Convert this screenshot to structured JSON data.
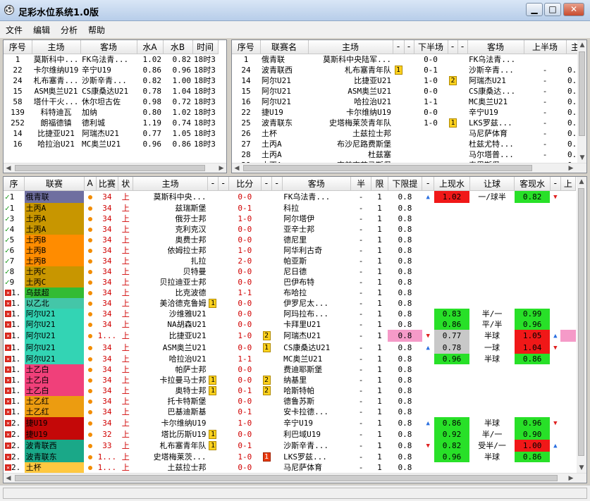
{
  "window": {
    "title": "足彩水位系统1.0版",
    "min": "▁",
    "max": "□",
    "close": "✕"
  },
  "menu": [
    "文件",
    "编辑",
    "分析",
    "帮助"
  ],
  "top_left": {
    "headers": [
      "序号",
      "主场",
      "客场",
      "水A",
      "水B",
      "时间"
    ],
    "rows": [
      [
        "1",
        "莫斯科中...",
        "FK乌法青...",
        "1.02",
        "0.82",
        "18时3"
      ],
      [
        "22",
        "卡尔维纳U19",
        "辛宁U19",
        "0.86",
        "0.96",
        "18时3"
      ],
      [
        "24",
        "札布塞青...",
        "沙斯辛青...",
        "0.82",
        "1.00",
        "18时3"
      ],
      [
        "15",
        "ASM奥兰U21",
        "CS康桑达U21",
        "0.78",
        "1.04",
        "18时3"
      ],
      [
        "58",
        "塔什干火...",
        "休尔坦古佐",
        "0.98",
        "0.72",
        "18时3"
      ],
      [
        "139",
        "科特迪瓦",
        "加纳",
        "0.80",
        "1.02",
        "18时3"
      ],
      [
        "252",
        "朗福德镇",
        "德利城",
        "1.19",
        "0.74",
        "18时3"
      ],
      [
        "14",
        "比捷亚U21",
        "阿瑞杰U21",
        "0.77",
        "1.05",
        "18时3"
      ],
      [
        "16",
        "哈拉治U21",
        "MC奥兰U21",
        "0.96",
        "0.86",
        "18时3"
      ]
    ]
  },
  "top_right": {
    "headers": [
      "序号",
      "联赛名",
      "主场",
      "-",
      "-",
      "下半场",
      "-",
      "-",
      "客场",
      "上半场",
      "主"
    ],
    "rows": [
      [
        "1",
        "俄青联",
        "莫斯科中央陆军...",
        "",
        "0-0",
        "",
        "FK乌法青...",
        "",
        ""
      ],
      [
        "24",
        "波青联西",
        "札布塞青年队",
        "1",
        "0-1",
        "",
        "沙斯辛青...",
        "-",
        "0."
      ],
      [
        "14",
        "阿尔U21",
        "比捷亚U21",
        "",
        "1-0",
        "2",
        "阿瑞杰U21",
        "-",
        "0."
      ],
      [
        "15",
        "阿尔U21",
        "ASM奥兰U21",
        "",
        "0-0",
        "",
        "CS康桑达...",
        "-",
        "0."
      ],
      [
        "16",
        "阿尔U21",
        "哈拉治U21",
        "",
        "1-1",
        "",
        "MC奥兰U21",
        "-",
        "0."
      ],
      [
        "22",
        "捷U19",
        "卡尔维纳U19",
        "",
        "0-0",
        "",
        "辛宁U19",
        "-",
        "0."
      ],
      [
        "25",
        "波青联东",
        "史塔梅莱茨青年队",
        "",
        "1-0",
        "1",
        "LKS罗兹...",
        "-",
        "0."
      ],
      [
        "26",
        "土杯",
        "土兹拉士邦",
        "",
        "",
        "",
        "马尼萨体育",
        "-",
        "0."
      ],
      [
        "27",
        "土丙A",
        "布沙尼路费斯堡",
        "",
        "",
        "",
        "杜兹尤特...",
        "-",
        "0."
      ],
      [
        "28",
        "土丙A",
        "杜兹塞",
        "",
        "",
        "",
        "马尔塔普...",
        "-",
        "0."
      ],
      [
        "29",
        "土丙A",
        "克兹查艾马斯堡",
        "",
        "",
        "",
        "泰里斯堡",
        "-",
        "0."
      ]
    ]
  },
  "main": {
    "headers": [
      "序",
      "联赛",
      "A",
      "比赛",
      "状",
      "主场",
      "-",
      "-",
      "比分",
      "-",
      "-",
      "客场",
      "半",
      "限",
      "下限提",
      "-",
      "上现水",
      "让球",
      "客现水",
      "-",
      "上"
    ],
    "rows": [
      {
        "mk": "ok",
        "n": "1",
        "lg": "俄青联",
        "lc": "#6f6fa0",
        "t": "34",
        "st": "上",
        "h": "莫斯科中央...",
        "hb": "",
        "s": "0-0",
        "ab": "",
        "a": "FK乌法青...",
        "half": "-",
        "lim": "1",
        "low": "0.8",
        "ar1": "up",
        "uw": "1.02",
        "uwc": "redc",
        "hc": "一/球半",
        "aw": "0.82",
        "awc": "grn",
        "ar2": "down"
      },
      {
        "mk": "ok",
        "n": "1",
        "lg": "土丙A",
        "lc": "#c89600",
        "t": "34",
        "st": "上",
        "h": "兹瑞斯堡",
        "hb": "",
        "s": "0-1",
        "ab": "",
        "a": "科拉",
        "half": "-",
        "lim": "1",
        "low": "0.8"
      },
      {
        "mk": "ok",
        "n": "3",
        "lg": "土丙A",
        "lc": "#c89600",
        "t": "34",
        "st": "上",
        "h": "俄芬士邦",
        "hb": "",
        "s": "1-0",
        "ab": "",
        "a": "阿尔塔伊",
        "half": "-",
        "lim": "1",
        "low": "0.8"
      },
      {
        "mk": "ok",
        "n": "4",
        "lg": "土丙A",
        "lc": "#c89600",
        "t": "34",
        "st": "上",
        "h": "克利克汉",
        "hb": "",
        "s": "0-0",
        "ab": "",
        "a": "亚辛士邦",
        "half": "-",
        "lim": "1",
        "low": "0.8"
      },
      {
        "mk": "ok",
        "n": "5",
        "lg": "土丙B",
        "lc": "#ff8c00",
        "t": "34",
        "st": "上",
        "h": "奥费士邦",
        "hb": "",
        "s": "0-0",
        "ab": "",
        "a": "德尼里",
        "half": "-",
        "lim": "1",
        "low": "0.8"
      },
      {
        "mk": "ok",
        "n": "6",
        "lg": "土丙B",
        "lc": "#ff8c00",
        "t": "34",
        "st": "上",
        "h": "依姆拉士邦",
        "hb": "",
        "s": "1-0",
        "ab": "",
        "a": "阿华利古奇",
        "half": "-",
        "lim": "1",
        "low": "0.8"
      },
      {
        "mk": "ok",
        "n": "7",
        "lg": "土丙B",
        "lc": "#ff8c00",
        "t": "34",
        "st": "上",
        "h": "扎拉",
        "hb": "",
        "s": "2-0",
        "ab": "",
        "a": "帕亚斯",
        "half": "-",
        "lim": "1",
        "low": "0.8"
      },
      {
        "mk": "ok",
        "n": "8",
        "lg": "土丙C",
        "lc": "#c89600",
        "t": "34",
        "st": "上",
        "h": "贝特曼",
        "hb": "",
        "s": "0-0",
        "ab": "",
        "a": "尼日德",
        "half": "-",
        "lim": "1",
        "low": "0.8"
      },
      {
        "mk": "ok",
        "n": "9",
        "lg": "土丙C",
        "lc": "#c89600",
        "t": "34",
        "st": "上",
        "h": "贝拉迪亚士邦",
        "hb": "",
        "s": "0-0",
        "ab": "",
        "a": "巴伊布特",
        "half": "-",
        "lim": "1",
        "low": "0.8"
      },
      {
        "mk": "x",
        "n": "1.",
        "lg": "乌兹超",
        "lc": "#33bb33",
        "t": "34",
        "st": "上",
        "h": "比克波德",
        "hb": "",
        "s": "1-1",
        "ab": "",
        "a": "布哈拉",
        "half": "-",
        "lim": "1",
        "low": "0.8"
      },
      {
        "mk": "x",
        "n": "1.",
        "lg": "以乙北",
        "lc": "#44c6a8",
        "t": "34",
        "st": "上",
        "h": "美洽德克鲁姆",
        "hb": "1",
        "s": "0-0",
        "ab": "",
        "a": "伊罗尼太...",
        "half": "-",
        "lim": "1",
        "low": "0.8"
      },
      {
        "mk": "x",
        "n": "1.",
        "lg": "阿尔U21",
        "lc": "#33d4b4",
        "t": "34",
        "st": "上",
        "h": "沙维雅U21",
        "hb": "",
        "s": "0-0",
        "ab": "",
        "a": "阿玛拉布...",
        "half": "-",
        "lim": "1",
        "low": "0.8",
        "uw": "0.83",
        "uwc": "grn",
        "hc": "半/一",
        "aw": "0.99",
        "awc": "grn"
      },
      {
        "mk": "x",
        "n": "1.",
        "lg": "阿尔U21",
        "lc": "#33d4b4",
        "t": "34",
        "st": "上",
        "h": "NA胡森U21",
        "hb": "",
        "s": "0-0",
        "ab": "",
        "a": "卡拜里U21",
        "half": "-",
        "lim": "1",
        "low": "0.8",
        "uw": "0.86",
        "uwc": "grn",
        "hc": "平/半",
        "aw": "0.96",
        "awc": "grn"
      },
      {
        "mk": "x",
        "n": "1.",
        "lg": "阿尔U21",
        "lc": "#33d4b4",
        "t": "1...",
        "st": "上",
        "h": "比捷亚U21",
        "hb": "",
        "s": "1-0",
        "ab": "2",
        "a": "阿瑞杰U21",
        "half": "-",
        "lim": "1",
        "low": "0.8",
        "lowc": "pnk",
        "ar1": "down",
        "uw": "0.77",
        "uwc": "gry",
        "hc": "半球",
        "aw": "1.05",
        "awc": "redc",
        "ar2": "up",
        "last": "pnk"
      },
      {
        "mk": "x",
        "n": "1.",
        "lg": "阿尔U21",
        "lc": "#33d4b4",
        "t": "34",
        "st": "上",
        "h": "ASM奥兰U21",
        "hb": "",
        "s": "0-0",
        "ab": "1",
        "a": "CS康桑达U21",
        "half": "-",
        "lim": "1",
        "low": "0.8",
        "ar1": "up",
        "uw": "0.78",
        "uwc": "gry",
        "hc": "一球",
        "aw": "1.04",
        "awc": "redc",
        "ar2": "down"
      },
      {
        "mk": "x",
        "n": "1.",
        "lg": "阿尔U21",
        "lc": "#33d4b4",
        "t": "34",
        "st": "上",
        "h": "哈拉治U21",
        "hb": "",
        "s": "1-1",
        "ab": "",
        "a": "MC奥兰U21",
        "half": "-",
        "lim": "1",
        "low": "0.8",
        "uw": "0.96",
        "uwc": "grn",
        "hc": "半球",
        "aw": "0.86",
        "awc": "grn"
      },
      {
        "mk": "x",
        "n": "1.",
        "lg": "土乙白",
        "lc": "#f0407a",
        "t": "34",
        "st": "上",
        "h": "帕萨士邦",
        "hb": "",
        "s": "0-0",
        "ab": "",
        "a": "费迪耶斯堡",
        "half": "-",
        "lim": "1",
        "low": "0.8"
      },
      {
        "mk": "x",
        "n": "1.",
        "lg": "土乙白",
        "lc": "#f0407a",
        "t": "34",
        "st": "上",
        "h": "卡拉曼马士邦",
        "hb": "1",
        "s": "0-0",
        "ab": "2",
        "a": "纳基里",
        "half": "-",
        "lim": "1",
        "low": "0.8"
      },
      {
        "mk": "x",
        "n": "1.",
        "lg": "土乙白",
        "lc": "#f0407a",
        "t": "34",
        "st": "上",
        "h": "奥特士邦",
        "hb": "1",
        "s": "0-1",
        "ab": "2",
        "a": "哈斯特帕",
        "half": "-",
        "lim": "1",
        "low": "0.8"
      },
      {
        "mk": "x",
        "n": "1.",
        "lg": "土乙红",
        "lc": "#ec9c10",
        "t": "34",
        "st": "上",
        "h": "托卡特斯堡",
        "hb": "",
        "s": "0-0",
        "ab": "",
        "a": "德鲁苏斯",
        "half": "-",
        "lim": "1",
        "low": "0.8"
      },
      {
        "mk": "x",
        "n": "1.",
        "lg": "土乙红",
        "lc": "#ec9c10",
        "t": "34",
        "st": "上",
        "h": "巴基迪斯基",
        "hb": "",
        "s": "0-1",
        "ab": "",
        "a": "安卡拉德...",
        "half": "-",
        "lim": "1",
        "low": "0.8"
      },
      {
        "mk": "x",
        "n": "2.",
        "lg": "捷U19",
        "lc": "#c40808",
        "t": "34",
        "st": "上",
        "h": "卡尔维纳U19",
        "hb": "",
        "s": "1-0",
        "ab": "",
        "a": "辛宁U19",
        "half": "-",
        "lim": "1",
        "low": "0.8",
        "ar1": "up",
        "uw": "0.86",
        "uwc": "grn",
        "hc": "半球",
        "aw": "0.96",
        "awc": "grn",
        "ar2": "down"
      },
      {
        "mk": "x",
        "n": "2.",
        "lg": "捷U19",
        "lc": "#c40808",
        "t": "32",
        "st": "上",
        "h": "塔比历斯U19",
        "hb": "1",
        "s": "0-0",
        "ab": "",
        "a": "利巴域U19",
        "half": "-",
        "lim": "1",
        "low": "0.8",
        "uw": "0.92",
        "uwc": "grn",
        "hc": "半/一",
        "aw": "0.90",
        "awc": "grn"
      },
      {
        "mk": "x",
        "n": "2.",
        "lg": "波青联西",
        "lc": "#1aa888",
        "t": "33",
        "st": "上",
        "h": "札布塞青年队",
        "hb": "1",
        "s": "0-1",
        "ab": "",
        "a": "沙斯辛青...",
        "half": "-",
        "lim": "1",
        "low": "0.8",
        "ar1": "down",
        "uw": "0.82",
        "uwc": "grn",
        "hc": "受半/一",
        "aw": "1.00",
        "awc": "redc",
        "ar2": "up"
      },
      {
        "mk": "x",
        "n": "2.",
        "lg": "波青联东",
        "lc": "#1aa888",
        "t": "1...",
        "st": "上",
        "h": "史塔梅莱茨...",
        "hb": "",
        "s": "1-0",
        "ab": "1r",
        "a": "LKS罗兹...",
        "half": "-",
        "lim": "1",
        "low": "0.8",
        "uw": "0.96",
        "uwc": "grn",
        "hc": "半球",
        "aw": "0.86",
        "awc": "grn"
      },
      {
        "mk": "x",
        "n": "2.",
        "lg": "土杯",
        "lc": "#ffc840",
        "t": "1...",
        "st": "上",
        "h": "土兹拉士邦",
        "hb": "",
        "s": "0-0",
        "ab": "",
        "a": "马尼萨体育",
        "half": "-",
        "lim": "1",
        "low": "0.8"
      },
      {
        "mk": "x",
        "n": "2.",
        "lg": "土丙A",
        "lc": "#c89600",
        "t": "1...",
        "st": "上",
        "h": "布沙尼路费...",
        "hb": "",
        "s": "0-0",
        "ab": "",
        "a": "杜兹尤特...",
        "half": "-",
        "lim": "1",
        "low": "0.8"
      }
    ]
  }
}
